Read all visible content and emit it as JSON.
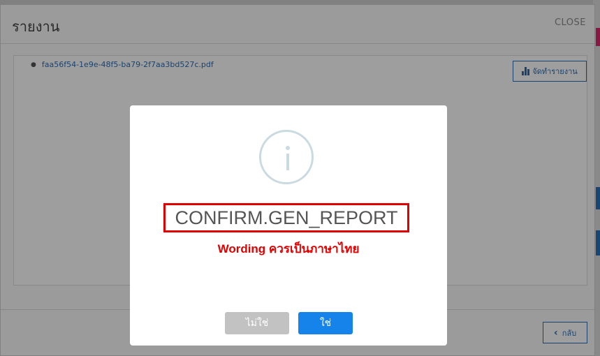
{
  "report_modal": {
    "title": "รายงาน",
    "close_label": "CLOSE",
    "files": [
      "faa56f54-1e9e-48f5-ba79-2f7aa3bd527c.pdf"
    ],
    "generate_button_label": "จัดทำรายงาน",
    "back_button_label": "กลับ"
  },
  "confirm_dialog": {
    "title": "CONFIRM.GEN_REPORT",
    "annotation": "Wording ควรเป็นภาษาไทย",
    "cancel_label": "ไม่ใช่",
    "ok_label": "ใช่"
  },
  "colors": {
    "accent": "#1583ea",
    "link": "#2a6db5",
    "annotation_red": "#e00000",
    "disabled_gray": "#c2c2c2"
  },
  "icons": [
    "bar-chart-icon",
    "chevron-left-icon",
    "info-icon"
  ]
}
